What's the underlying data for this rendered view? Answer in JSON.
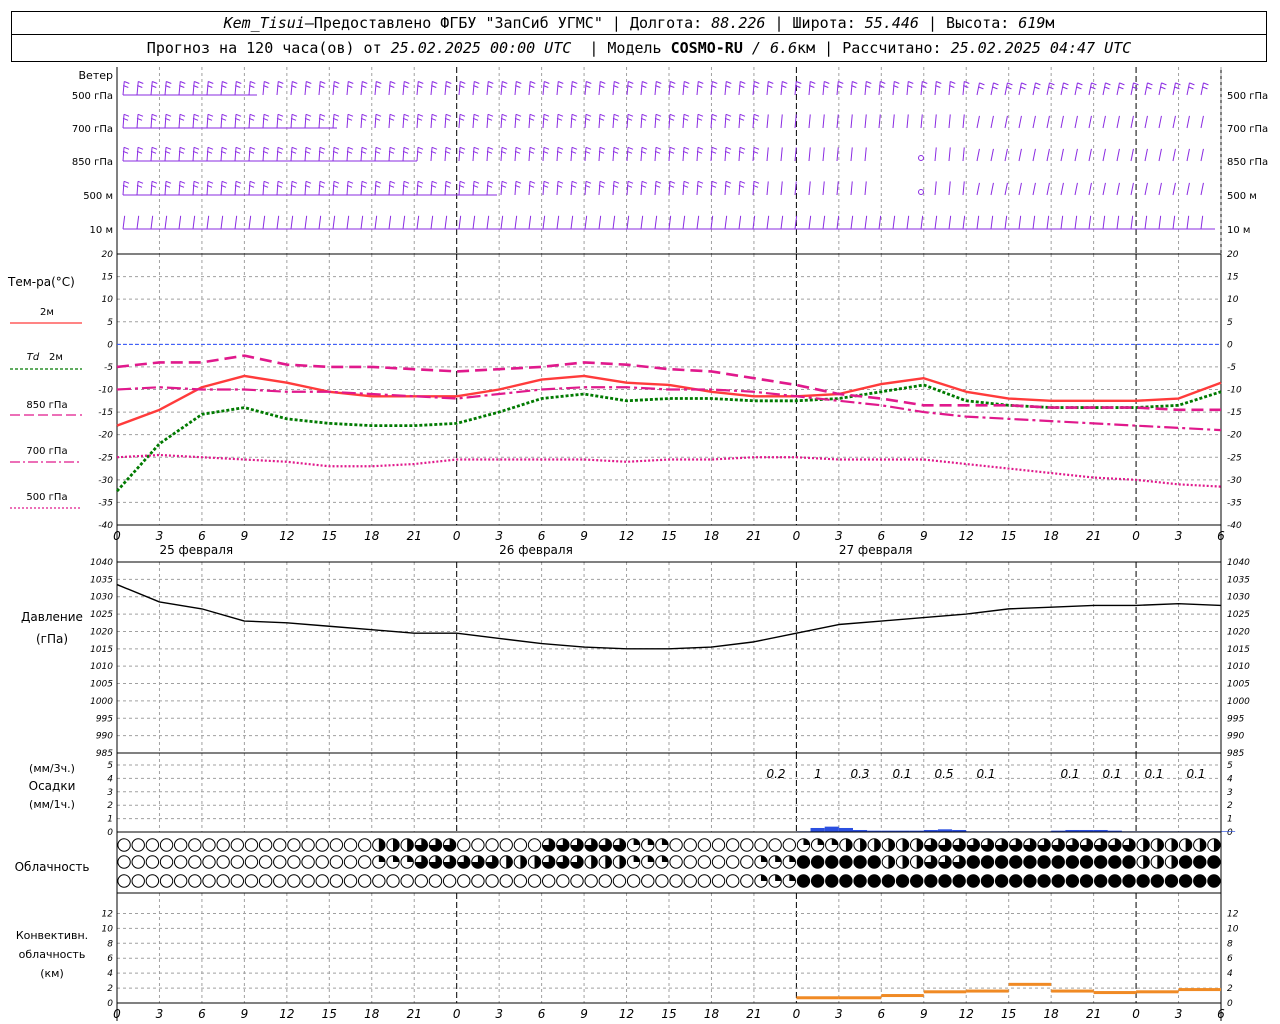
{
  "header": {
    "station": "Kem_Tisui",
    "dash": " — ",
    "provider": "Предоставлено ФГБУ \"ЗапСиб УГМС\"",
    "lon_label": "Долгота:",
    "lon_value": "88.226",
    "lat_label": "Широта:",
    "lat_value": "55.446",
    "alt_label": "Высота:",
    "alt_value": "619",
    "alt_unit": "м",
    "forecast_label": "Прогноз на 120 часа(ов) от",
    "forecast_from": "25.02.2025 00:00 UTC",
    "model_label": "Модель",
    "model_name": "COSMO-RU",
    "model_res": "/ 6.6",
    "model_unit": "км",
    "calc_label": "Рассчитано:",
    "calc_time": "25.02.2025 04:47 UTC"
  },
  "labels": {
    "wind": "Ветер",
    "temp": "Тем-ра(°C)",
    "t2m": "2м",
    "td": "Td",
    "td_2m": "2м",
    "t850": "850 гПа",
    "t700": "700 гПа",
    "t500": "500 гПа",
    "pressure": "Давление",
    "pressure_unit": "(гПа)",
    "precip_3h": "(мм/3ч.)",
    "precip": "Осадки",
    "precip_1h": "(мм/1ч.)",
    "cloud": "Облачность",
    "conv1": "Конвективн.",
    "conv2": "облачность",
    "conv_unit": "(км)",
    "dates": [
      "25 февраля",
      "26 февраля",
      "27 февраля"
    ]
  },
  "wind_levels": [
    "500 гПа",
    "700 гПа",
    "850 гПа",
    "500 м",
    "10 м"
  ],
  "time_ticks": [
    "0",
    "3",
    "6",
    "9",
    "12",
    "15",
    "18",
    "21",
    "0",
    "3",
    "6",
    "9",
    "12",
    "15",
    "18",
    "21",
    "0",
    "3",
    "6",
    "9",
    "12",
    "15",
    "18",
    "21",
    "0",
    "3",
    "6"
  ],
  "temp_ticks": [
    "20",
    "15",
    "10",
    "5",
    "0",
    "-5",
    "-10",
    "-15",
    "-20",
    "-25",
    "-30",
    "-35",
    "-40"
  ],
  "pressure_ticks": [
    "1040",
    "1035",
    "1030",
    "1025",
    "1020",
    "1015",
    "1010",
    "1005",
    "1000",
    "995",
    "990",
    "985"
  ],
  "precip_ticks": [
    "5",
    "4",
    "3",
    "2",
    "1",
    "0",
    "5",
    "4",
    "3",
    "2",
    "1",
    "0"
  ],
  "conv_ticks": [
    "12",
    "10",
    "8",
    "6",
    "4",
    "2",
    "0"
  ],
  "precip_totals": [
    "0.2",
    "1",
    "0.3",
    "0.1",
    "0.5",
    "0.1",
    "0.1",
    "0.1",
    "0.1",
    "0.1"
  ],
  "colors": {
    "wind": "#8a2be2",
    "t2m": "#ff3b3b",
    "td": "#007a00",
    "t850": "#e0198c",
    "t700": "#e0198c",
    "t500": "#e0198c",
    "zero_line": "#3355ff",
    "pressure": "#000000",
    "precip": "#2b4fe0",
    "conv": "#f08a24",
    "grid": "#a0a0a0"
  },
  "chart_data": [
    {
      "type": "line",
      "title": "Тем-ра(°C)",
      "x_unit": "hours from 25.02.2025 00:00 UTC",
      "ylim": [
        -40,
        20
      ],
      "grid": true,
      "series": [
        {
          "name": "2м",
          "x": [
            0,
            3,
            6,
            9,
            12,
            15,
            18,
            21,
            24,
            27,
            30,
            33,
            36,
            39,
            42,
            45,
            48,
            51,
            54,
            57,
            60,
            63,
            66,
            69,
            72,
            75,
            78
          ],
          "values": [
            -18,
            -14.5,
            -9.5,
            -7,
            -8.5,
            -10.5,
            -11.5,
            -11.5,
            -11.5,
            -10,
            -7.8,
            -7,
            -8.5,
            -9,
            -10.5,
            -11.5,
            -11.5,
            -11,
            -8.8,
            -7.5,
            -10.5,
            -12,
            -12.5,
            -12.5,
            -12.5,
            -12,
            -8.5
          ]
        },
        {
          "name": "Td 2м",
          "x": [
            0,
            3,
            6,
            9,
            12,
            15,
            18,
            21,
            24,
            27,
            30,
            33,
            36,
            39,
            42,
            45,
            48,
            51,
            54,
            57,
            60,
            63,
            66,
            69,
            72,
            75,
            78
          ],
          "values": [
            -32.5,
            -22,
            -15.5,
            -14,
            -16.5,
            -17.5,
            -18,
            -18,
            -17.5,
            -15,
            -12,
            -11,
            -12.5,
            -12,
            -12,
            -12.5,
            -12.5,
            -12,
            -10.5,
            -9,
            -12.5,
            -13.5,
            -14,
            -14,
            -14,
            -13.5,
            -10.5
          ]
        },
        {
          "name": "850 гПа",
          "x": [
            0,
            3,
            6,
            9,
            12,
            15,
            18,
            21,
            24,
            27,
            30,
            33,
            36,
            39,
            42,
            45,
            48,
            51,
            54,
            57,
            60,
            63,
            66,
            69,
            72,
            75,
            78
          ],
          "values": [
            -5,
            -4,
            -4,
            -2.5,
            -4.5,
            -5,
            -5,
            -5.5,
            -6,
            -5.5,
            -5,
            -4,
            -4.5,
            -5.5,
            -6,
            -7.5,
            -9,
            -11,
            -12,
            -13.5,
            -13.5,
            -13.5,
            -14,
            -14,
            -14,
            -14.5,
            -14.5
          ]
        },
        {
          "name": "700 гПа",
          "x": [
            0,
            3,
            6,
            9,
            12,
            15,
            18,
            21,
            24,
            27,
            30,
            33,
            36,
            39,
            42,
            45,
            48,
            51,
            54,
            57,
            60,
            63,
            66,
            69,
            72,
            75,
            78
          ],
          "values": [
            -10,
            -9.5,
            -10,
            -10,
            -10.5,
            -10.5,
            -11,
            -11.5,
            -12,
            -11,
            -10,
            -9.5,
            -9.5,
            -10,
            -10,
            -10.5,
            -11.5,
            -12.5,
            -13.5,
            -15,
            -16,
            -16.5,
            -17,
            -17.5,
            -18,
            -18.5,
            -19
          ]
        },
        {
          "name": "500 гПа",
          "x": [
            0,
            3,
            6,
            9,
            12,
            15,
            18,
            21,
            24,
            27,
            30,
            33,
            36,
            39,
            42,
            45,
            48,
            51,
            54,
            57,
            60,
            63,
            66,
            69,
            72,
            75,
            78
          ],
          "values": [
            -25,
            -24.5,
            -25,
            -25.5,
            -26,
            -27,
            -27,
            -26.5,
            -25.5,
            -25.5,
            -25.5,
            -25.5,
            -26,
            -25.5,
            -25.5,
            -25,
            -25,
            -25.5,
            -25.5,
            -25.5,
            -26.5,
            -27.5,
            -28.5,
            -29.5,
            -30,
            -31,
            -31.5
          ]
        }
      ]
    },
    {
      "type": "line",
      "title": "Давление",
      "ylabel": "(гПа)",
      "ylim": [
        985,
        1040
      ],
      "grid": true,
      "series": [
        {
          "name": "Давление",
          "x": [
            0,
            3,
            6,
            9,
            12,
            15,
            18,
            21,
            24,
            27,
            30,
            33,
            36,
            39,
            42,
            45,
            48,
            51,
            54,
            57,
            60,
            63,
            66,
            69,
            72,
            75,
            78
          ],
          "values": [
            1033.5,
            1028.5,
            1026.5,
            1023,
            1022.5,
            1021.5,
            1020.5,
            1019.5,
            1019.5,
            1018,
            1016.5,
            1015.5,
            1015,
            1015,
            1015.5,
            1017,
            1019.5,
            1022,
            1023,
            1024,
            1025,
            1026.5,
            1027,
            1027.5,
            1027.5,
            1028,
            1027.5
          ]
        }
      ]
    },
    {
      "type": "bar",
      "title": "Осадки",
      "ylabel": "(мм/1ч.)",
      "ylim": [
        0,
        5
      ],
      "x": [
        48,
        49,
        50,
        51,
        52,
        53,
        54,
        55,
        56,
        57,
        58,
        59,
        60,
        61,
        62,
        63,
        64,
        65,
        66,
        67,
        68,
        69,
        70,
        71,
        72,
        73,
        74,
        75,
        76,
        77,
        78
      ],
      "values": [
        0.05,
        0.3,
        0.4,
        0.3,
        0.15,
        0.1,
        0.1,
        0.1,
        0.1,
        0.15,
        0.2,
        0.15,
        0.05,
        0.05,
        0.05,
        0.05,
        0.05,
        0.05,
        0.1,
        0.15,
        0.15,
        0.15,
        0.1,
        0.05,
        0.05,
        0.05,
        0.05,
        0.05,
        0.05,
        0.05,
        0.05
      ],
      "totals_3h": [
        0.2,
        1,
        0.3,
        0.1,
        0.5,
        0.1,
        0,
        0.1,
        0.1,
        0.1,
        0.1
      ]
    },
    {
      "type": "table",
      "title": "Облачность",
      "x": [
        0,
        3,
        6,
        9,
        12,
        15,
        18,
        21,
        24,
        27,
        30,
        33,
        36,
        39,
        42,
        45,
        48,
        51,
        54,
        57,
        60,
        63,
        66,
        69,
        72,
        75,
        78
      ],
      "rows": [
        {
          "name": "upper",
          "fraction": [
            0,
            0,
            0,
            0,
            0,
            0,
            0.5,
            0.75,
            0,
            0,
            0.75,
            0.75,
            0.25,
            0,
            0,
            0,
            0.25,
            0.5,
            0.5,
            0.75,
            0.75,
            0.75,
            0.75,
            0.75,
            0.5,
            0.5,
            0.75
          ]
        },
        {
          "name": "middle",
          "fraction": [
            0,
            0,
            0,
            0,
            0,
            0,
            0.25,
            0.75,
            0.75,
            0.5,
            0.75,
            0.5,
            0.25,
            0,
            0,
            0.25,
            1,
            1,
            0.5,
            0.75,
            1,
            1,
            1,
            1,
            0.5,
            1,
            1
          ]
        },
        {
          "name": "lower",
          "fraction": [
            0,
            0,
            0,
            0,
            0,
            0,
            0,
            0,
            0,
            0,
            0,
            0,
            0,
            0,
            0,
            0.25,
            1,
            1,
            1,
            1,
            1,
            1,
            1,
            1,
            1,
            1,
            1
          ]
        }
      ]
    },
    {
      "type": "bar",
      "title": "Конвективн. облачность",
      "ylabel": "(км)",
      "ylim": [
        0,
        13
      ],
      "x": [
        48,
        51,
        54,
        57,
        60,
        63,
        66,
        69,
        72,
        75,
        78
      ],
      "values": [
        0.7,
        0.7,
        1,
        1.5,
        1.6,
        2.5,
        1.6,
        1.4,
        1.5,
        1.8,
        1
      ]
    }
  ]
}
